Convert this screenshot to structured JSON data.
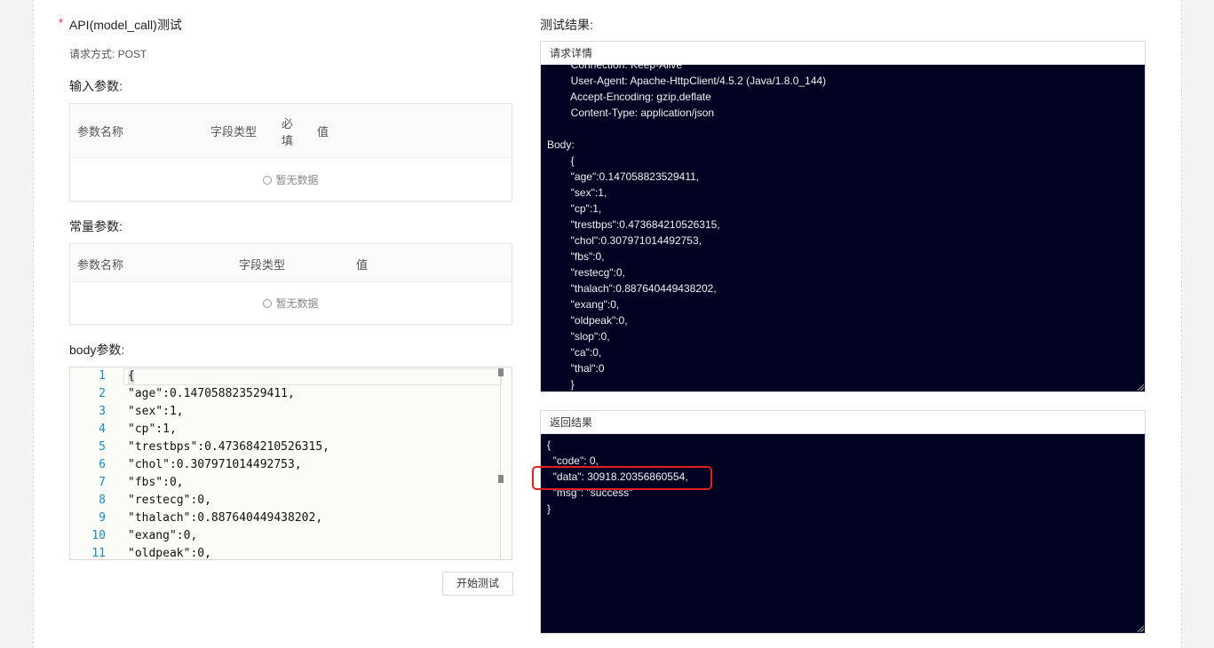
{
  "left": {
    "api_label": "API(model_call)测试",
    "request_method": "请求方式: POST",
    "input_params_title": "输入参数:",
    "input_table": {
      "col_name": "参数名称",
      "col_type": "字段类型",
      "col_required_1": "必",
      "col_required_2": "填",
      "col_value": "值",
      "empty_text": "暂无数据"
    },
    "const_params_title": "常量参数:",
    "const_table": {
      "col_name": "参数名称",
      "col_type": "字段类型",
      "col_value": "值",
      "empty_text": "暂无数据"
    },
    "body_params_title": "body参数:",
    "editor_lines": [
      {
        "num": "1",
        "code": "{"
      },
      {
        "num": "2",
        "code": "\"age\":0.147058823529411,"
      },
      {
        "num": "3",
        "code": "\"sex\":1,"
      },
      {
        "num": "4",
        "code": "\"cp\":1,"
      },
      {
        "num": "5",
        "code": "\"trestbps\":0.473684210526315,"
      },
      {
        "num": "6",
        "code": "\"chol\":0.307971014492753,"
      },
      {
        "num": "7",
        "code": "\"fbs\":0,"
      },
      {
        "num": "8",
        "code": "\"restecg\":0,"
      },
      {
        "num": "9",
        "code": "\"thalach\":0.887640449438202,"
      },
      {
        "num": "10",
        "code": "\"exang\":0,"
      },
      {
        "num": "11",
        "code": "\"oldpeak\":0,"
      }
    ],
    "start_button": "开始测试"
  },
  "right": {
    "result_title": "测试结果:",
    "request_detail": {
      "title": "请求详情",
      "lines": [
        "        Connection: Keep-Alive",
        "        User-Agent: Apache-HttpClient/4.5.2 (Java/1.8.0_144)",
        "        Accept-Encoding: gzip,deflate",
        "        Content-Type: application/json",
        "",
        "Body:",
        "        {",
        "        \"age\":0.147058823529411,",
        "        \"sex\":1,",
        "        \"cp\":1,",
        "        \"trestbps\":0.473684210526315,",
        "        \"chol\":0.307971014492753,",
        "        \"fbs\":0,",
        "        \"restecg\":0,",
        "        \"thalach\":0.887640449438202,",
        "        \"exang\":0,",
        "        \"oldpeak\":0,",
        "        \"slop\":0,",
        "        \"ca\":0,",
        "        \"thal\":0",
        "        }"
      ]
    },
    "return_result": {
      "title": "返回结果",
      "lines": [
        "{",
        "  \"code\": 0,",
        "  \"data\": 30918.20356860554,",
        "  \"msg\": \"success\"",
        "}"
      ]
    }
  },
  "colors": {
    "terminal_bg": "#020322",
    "highlight": "#e0201c",
    "line_number": "#1c8dbf",
    "required_star": "#f5222d"
  }
}
